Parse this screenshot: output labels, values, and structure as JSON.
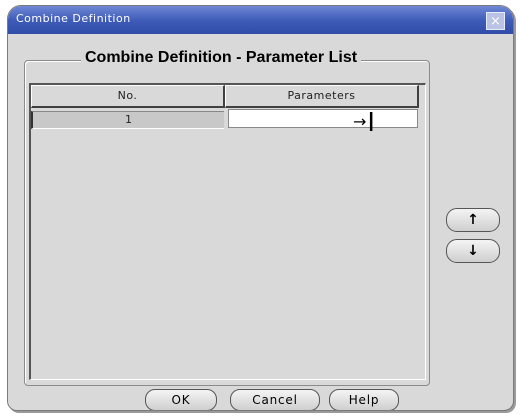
{
  "window": {
    "title": "Combine Definition",
    "close_symbol": "×"
  },
  "group": {
    "title": "Combine Definition - Parameter List"
  },
  "table": {
    "columns": [
      "No.",
      "Parameters"
    ],
    "rows": [
      {
        "no": "1",
        "parameters": ""
      }
    ]
  },
  "cursor": {
    "icon": "tab-cursor-icon",
    "glyph": "→┃"
  },
  "side_buttons": {
    "up_glyph": "↑",
    "down_glyph": "↓"
  },
  "buttons": {
    "ok": "OK",
    "cancel": "Cancel",
    "help": "Help"
  },
  "colors": {
    "titlebar": "#3f5cb8",
    "window_bg": "#d9d9d9"
  }
}
